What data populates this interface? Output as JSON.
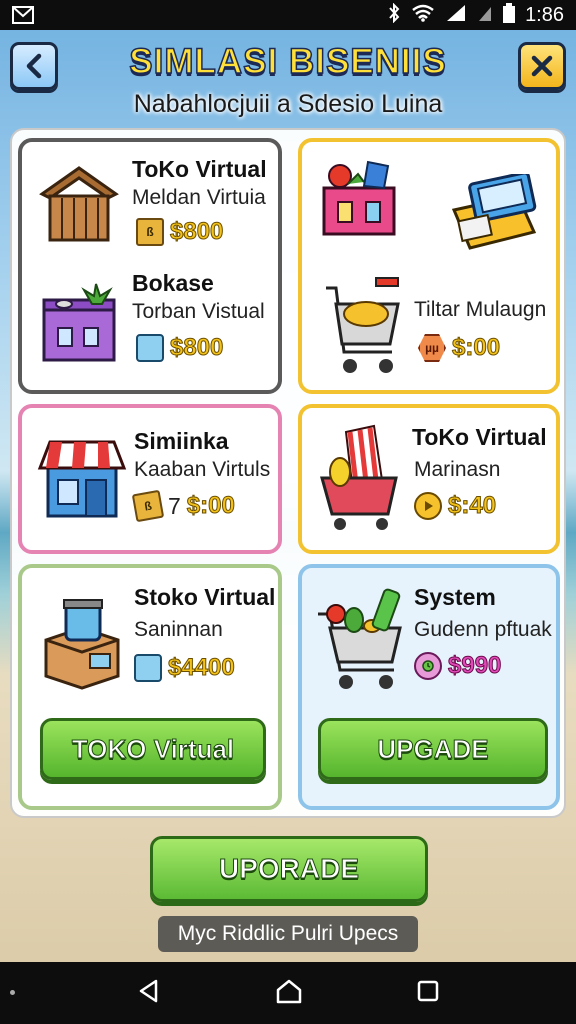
{
  "status_bar": {
    "time": "1:86"
  },
  "header": {
    "title": "SIMLASI BISENIIS",
    "subtitle": "Nabahlocjuii a Sdesio Luina"
  },
  "cards": [
    {
      "title": "ToKo Virtual",
      "subtitle": "Meldan Virtuia",
      "price": "$800",
      "badge": "ß"
    },
    {
      "title": "Bokase",
      "subtitle": "Torban Vistual",
      "price": "$800"
    },
    {
      "title": "",
      "subtitle": "Tiltar Mulaugn",
      "price": "$:00",
      "badge": "µµ"
    },
    {
      "title": "Simiinka",
      "subtitle": "Kaaban Virtuls",
      "price_prefix": "7",
      "price": "$:00",
      "badge": "ß"
    },
    {
      "title": "ToKo Virtual",
      "subtitle": "Marinasn",
      "price": "$:40"
    },
    {
      "title": "Stoko Virtual",
      "subtitle": "Saninnan",
      "price": "$4400"
    },
    {
      "title": "System",
      "subtitle": "Gudenn pftuak",
      "price": "$990"
    }
  ],
  "buttons": {
    "toko_virtual": "TOKO Virtual",
    "upgade": "UPGADE",
    "uporade": "UPORADE"
  },
  "footer_label": "Myc Riddlic Pulri Upecs",
  "colors": {
    "title_yellow": "#ffe03a",
    "price_gold": "#f3c21a",
    "system_price": "#e040b0",
    "button_green": "#55b52d",
    "card_border_dark": "#666666",
    "card_border_yellow": "#f2c230",
    "card_border_pink": "#e583b3",
    "card_border_green": "#a9c98a",
    "card_border_blue": "#8fc4ea"
  }
}
